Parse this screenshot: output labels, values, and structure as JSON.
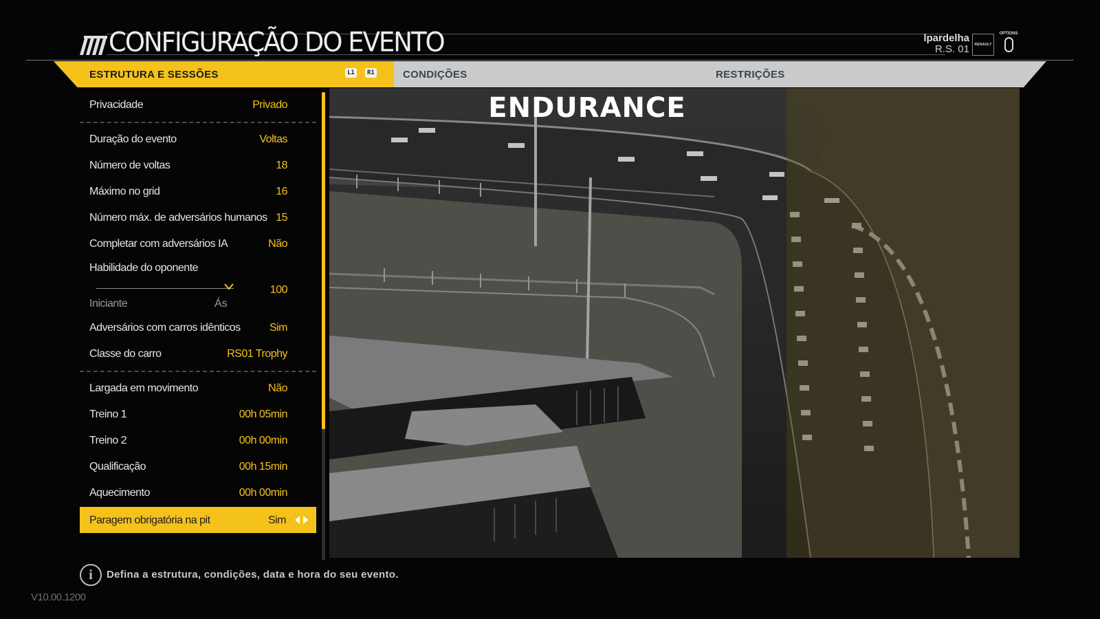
{
  "header": {
    "title": "CONFIGURAÇÃO DO EVENTO",
    "logo_icon": "stripes-logo-icon",
    "profile_name": "lpardelha",
    "profile_car": "R.S. 01",
    "brand_badge": "RENAULT",
    "options_label": "OPTIONS",
    "options_icon": "options-button-icon"
  },
  "tabs": [
    {
      "label": "ESTRUTURA E SESSÕES",
      "active": true
    },
    {
      "label": "CONDIÇÕES",
      "active": false
    },
    {
      "label": "RESTRIÇÕES",
      "active": false
    }
  ],
  "tab_buttons": {
    "left": "L1",
    "right": "R1"
  },
  "settings": {
    "privacy": {
      "label": "Privacidade",
      "value": "Privado"
    },
    "event_duration": {
      "label": "Duração do evento",
      "value": "Voltas"
    },
    "laps": {
      "label": "Número de voltas",
      "value": "18"
    },
    "grid_max": {
      "label": "Máximo no grid",
      "value": "16"
    },
    "max_humans": {
      "label": "Número máx. de adversários humanos",
      "value": "15"
    },
    "fill_ai": {
      "label": "Completar com adversários IA",
      "value": "Não"
    },
    "opponent_skill": {
      "label": "Habilidade do oponente",
      "value": "100",
      "level": 1.0,
      "min_label": "Iniciante",
      "max_label": "Ás"
    },
    "identical_cars": {
      "label": "Adversários com carros idênticos",
      "value": "Sim"
    },
    "car_class": {
      "label": "Classe do carro",
      "value": "RS01 Trophy"
    },
    "rolling_start": {
      "label": "Largada em movimento",
      "value": "Não"
    },
    "practice1": {
      "label": "Treino 1",
      "value": "00h 05min"
    },
    "practice2": {
      "label": "Treino 2",
      "value": "00h 00min"
    },
    "qualifying": {
      "label": "Qualificação",
      "value": "00h 15min"
    },
    "warmup": {
      "label": "Aquecimento",
      "value": "00h 00min"
    },
    "mandatory_pit": {
      "label": "Paragem obrigatória na pit",
      "value": "Sim",
      "selected": true
    }
  },
  "preview": {
    "title": "ENDURANCE"
  },
  "footer": {
    "help_text": "Defina a estrutura, condições, data e hora do seu evento.",
    "version": "V10.00.1200"
  },
  "colors": {
    "accent": "#f5c21b",
    "tab_bar": "#c9cbcd",
    "background": "#050505"
  }
}
